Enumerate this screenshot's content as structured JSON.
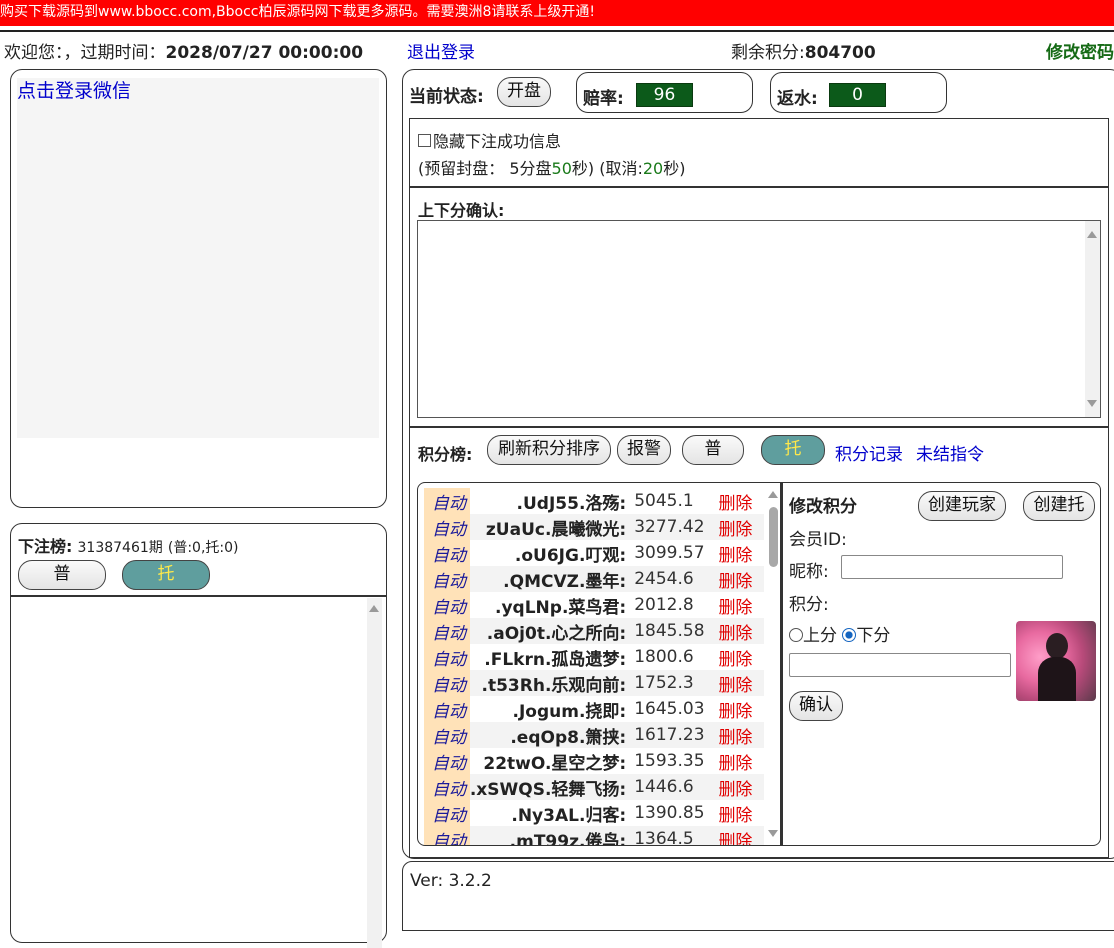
{
  "banner": "购买下载源码到www.bbocc.com,Bbocc柏辰源码网下载更多源码。需要澳洲8请联系上级开通!",
  "header": {
    "welcome": "欢迎您：",
    "expire_label": "，过期时间：",
    "expire_value": "2028/07/27 00:00:00",
    "logout": "退出登录",
    "points_label": "剩余积分:",
    "points_value": "804700",
    "change_password": "修改密码"
  },
  "wechat": {
    "login_link": "点击登录微信"
  },
  "bets": {
    "title": "下注榜:",
    "period": "31387461期",
    "summary": "(普:0,托:0)",
    "btn_normal": "普",
    "btn_tuo": "托"
  },
  "status": {
    "label": "当前状态:",
    "open_button": "开盘",
    "odds_label": "赔率:",
    "odds_value": "96",
    "rebate_label": "返水:",
    "rebate_value": "0"
  },
  "options": {
    "hide_success": "隐藏下注成功信息",
    "reserve_prefix": "(预留封盘：",
    "reserve_mid": "5分盘",
    "reserve_seconds": "50",
    "reserve_unit": "秒)",
    "cancel_prefix": "(取消:",
    "cancel_seconds": "20",
    "cancel_unit": "秒)"
  },
  "confirm": {
    "title": "上下分确认:"
  },
  "ranking": {
    "title": "积分榜:",
    "refresh_button": "刷新积分排序",
    "alarm_button": "报警",
    "normal_button": "普",
    "tuo_button": "托",
    "record_link": "积分记录",
    "pending_link": "未结指令",
    "delete_label": "删除",
    "rows": [
      {
        "mode": "自动",
        "name": ".UdJ55.洛殇:",
        "score": "5045.1"
      },
      {
        "mode": "自动",
        "name": "zUaUc.晨曦微光:",
        "score": "3277.42"
      },
      {
        "mode": "自动",
        "name": ".oU6JG.叮观:",
        "score": "3099.57"
      },
      {
        "mode": "自动",
        "name": ".QMCVZ.墨年:",
        "score": "2454.6"
      },
      {
        "mode": "自动",
        "name": ".yqLNp.菜鸟君:",
        "score": "2012.8"
      },
      {
        "mode": "自动",
        "name": ".aOj0t.心之所向:",
        "score": "1845.58"
      },
      {
        "mode": "自动",
        "name": ".FLkrn.孤岛遗梦:",
        "score": "1800.6"
      },
      {
        "mode": "自动",
        "name": ".t53Rh.乐观向前:",
        "score": "1752.3"
      },
      {
        "mode": "自动",
        "name": ".Jogum.挠即:",
        "score": "1645.03"
      },
      {
        "mode": "自动",
        "name": ".eqOp8.箫挟:",
        "score": "1617.23"
      },
      {
        "mode": "自动",
        "name": "22twO.星空之梦:",
        "score": "1593.35"
      },
      {
        "mode": "自动",
        "name": ".xSWQS.轻舞飞扬:",
        "score": "1446.6"
      },
      {
        "mode": "自动",
        "name": ".Ny3AL.归客:",
        "score": "1390.85"
      },
      {
        "mode": "自动",
        "name": ".mT99z.倦鸟:",
        "score": "1364.5"
      }
    ]
  },
  "modify": {
    "title": "修改积分",
    "create_player": "创建玩家",
    "create_tuo": "创建托",
    "member_id_label": "会员ID:",
    "nickname_label": "昵称:",
    "points_label": "积分:",
    "up_label": "上分",
    "down_label": "下分",
    "confirm_button": "确认"
  },
  "footer": {
    "version": "Ver: 3.2.2"
  }
}
